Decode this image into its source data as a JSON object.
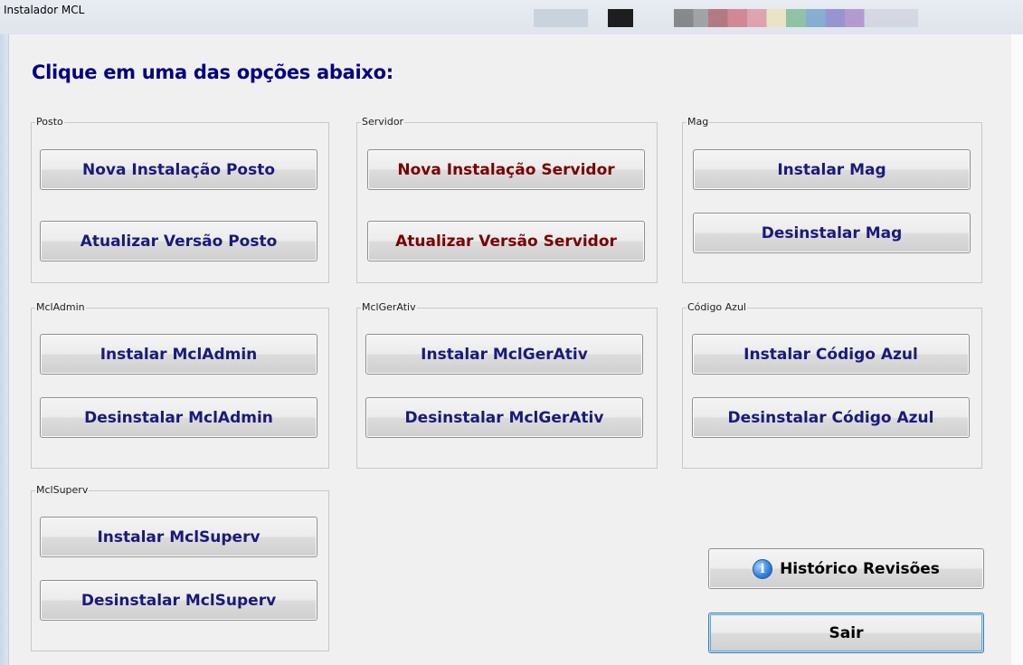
{
  "window": {
    "title": "Instalador MCL"
  },
  "heading": "Clique em uma das opções abaixo:",
  "groups": {
    "posto": {
      "label": "Posto",
      "buttons": [
        "Nova Instalação Posto",
        "Atualizar Versão Posto"
      ]
    },
    "servidor": {
      "label": "Servidor",
      "buttons": [
        "Nova Instalação Servidor",
        "Atualizar Versão Servidor"
      ]
    },
    "mag": {
      "label": "Mag",
      "buttons": [
        "Instalar Mag",
        "Desinstalar Mag"
      ]
    },
    "mcladmin": {
      "label": "MclAdmin",
      "buttons": [
        "Instalar MclAdmin",
        "Desinstalar MclAdmin"
      ]
    },
    "mclgerativ": {
      "label": "MclGerAtiv",
      "buttons": [
        "Instalar MclGerAtiv",
        "Desinstalar MclGerAtiv"
      ]
    },
    "codigoazul": {
      "label": "Código Azul",
      "buttons": [
        "Instalar Código Azul",
        "Desinstalar Código Azul"
      ]
    },
    "mclsuperv": {
      "label": "MclSuperv",
      "buttons": [
        "Instalar MclSuperv",
        "Desinstalar MclSuperv"
      ]
    }
  },
  "actions": {
    "historico": "Histórico Revisões",
    "historico_icon": "info-icon",
    "sair": "Sair"
  },
  "colors": {
    "heading": "#000080",
    "button_text_blue": "#1a1a7a",
    "button_text_red": "#7a0000"
  }
}
